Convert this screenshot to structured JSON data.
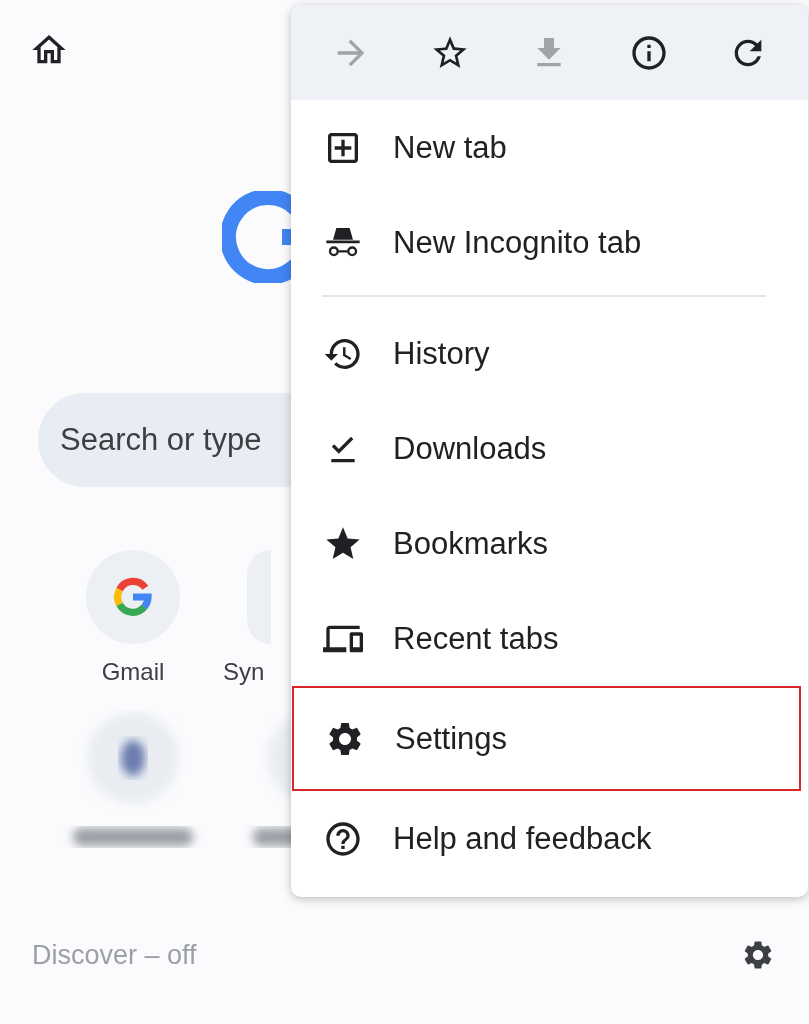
{
  "page": {
    "search": {
      "placeholder": "Search or type"
    },
    "shortcuts": [
      {
        "kind": "google",
        "label": "Gmail"
      },
      {
        "kind": "cut",
        "label": "Syn"
      },
      {
        "kind": "blurred"
      },
      {
        "kind": "blurred"
      }
    ],
    "discover": "Discover – off"
  },
  "menu": {
    "toolbar": [
      {
        "kind": "forward",
        "disabled": true
      },
      {
        "kind": "star",
        "disabled": false
      },
      {
        "kind": "download",
        "disabled": true
      },
      {
        "kind": "info",
        "disabled": false
      },
      {
        "kind": "refresh",
        "disabled": false
      }
    ],
    "sections": [
      [
        {
          "kind": "new-tab",
          "label": "New tab",
          "highlighted": false
        },
        {
          "kind": "incognito",
          "label": "New Incognito tab",
          "highlighted": false
        }
      ],
      [
        {
          "kind": "history",
          "label": "History",
          "highlighted": false
        },
        {
          "kind": "downloads",
          "label": "Downloads",
          "highlighted": false
        },
        {
          "kind": "bookmarks",
          "label": "Bookmarks",
          "highlighted": false
        },
        {
          "kind": "recent",
          "label": "Recent tabs",
          "highlighted": false
        },
        {
          "kind": "settings",
          "label": "Settings",
          "highlighted": true
        },
        {
          "kind": "help",
          "label": "Help and feedback",
          "highlighted": false
        }
      ]
    ]
  }
}
